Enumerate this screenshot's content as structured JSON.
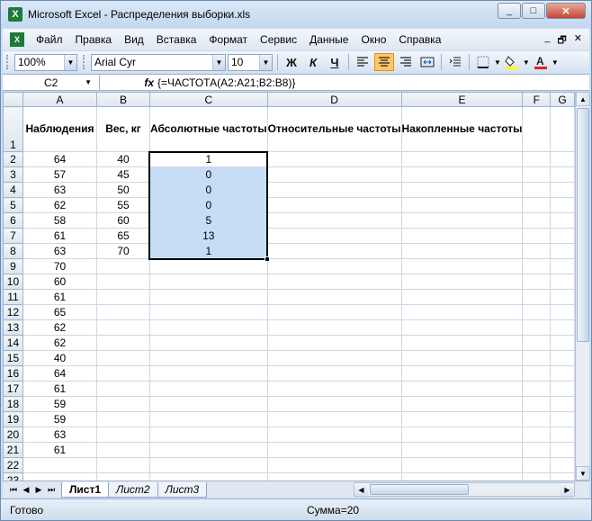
{
  "window": {
    "title": "Microsoft Excel - Распределения выборки.xls",
    "minimize": "_",
    "maximize": "□",
    "close": "✕"
  },
  "menu": {
    "items": [
      "Файл",
      "Правка",
      "Вид",
      "Вставка",
      "Формат",
      "Сервис",
      "Данные",
      "Окно",
      "Справка"
    ],
    "doc_minimize": "_",
    "doc_restore": "🗗",
    "doc_close": "✕"
  },
  "toolbar": {
    "zoom": "100%",
    "font_name": "Arial Cyr",
    "font_size": "10",
    "bold": "Ж",
    "italic": "К",
    "underline": "Ч",
    "font_color": "#e02020",
    "fill_color": "#ffff00"
  },
  "formula_bar": {
    "name_box": "C2",
    "fx": "fx",
    "formula": "{=ЧАСТОТА(A2:A21;B2:B8)}"
  },
  "sheet": {
    "columns": [
      "A",
      "B",
      "C",
      "D",
      "E",
      "F",
      "G"
    ],
    "header_row": {
      "row": "1",
      "A": "Наблюдения",
      "B": "Вес, кг",
      "C": "Абсолютные частоты",
      "D": "Относительные частоты",
      "E": "Накопленные частоты"
    },
    "rows": [
      {
        "row": "2",
        "A": "64",
        "B": "40",
        "C": "1"
      },
      {
        "row": "3",
        "A": "57",
        "B": "45",
        "C": "0"
      },
      {
        "row": "4",
        "A": "63",
        "B": "50",
        "C": "0"
      },
      {
        "row": "5",
        "A": "62",
        "B": "55",
        "C": "0"
      },
      {
        "row": "6",
        "A": "58",
        "B": "60",
        "C": "5"
      },
      {
        "row": "7",
        "A": "61",
        "B": "65",
        "C": "13"
      },
      {
        "row": "8",
        "A": "63",
        "B": "70",
        "C": "1"
      },
      {
        "row": "9",
        "A": "70",
        "B": "",
        "C": ""
      },
      {
        "row": "10",
        "A": "60",
        "B": "",
        "C": ""
      },
      {
        "row": "11",
        "A": "61",
        "B": "",
        "C": ""
      },
      {
        "row": "12",
        "A": "65",
        "B": "",
        "C": ""
      },
      {
        "row": "13",
        "A": "62",
        "B": "",
        "C": ""
      },
      {
        "row": "14",
        "A": "62",
        "B": "",
        "C": ""
      },
      {
        "row": "15",
        "A": "40",
        "B": "",
        "C": ""
      },
      {
        "row": "16",
        "A": "64",
        "B": "",
        "C": ""
      },
      {
        "row": "17",
        "A": "61",
        "B": "",
        "C": ""
      },
      {
        "row": "18",
        "A": "59",
        "B": "",
        "C": ""
      },
      {
        "row": "19",
        "A": "59",
        "B": "",
        "C": ""
      },
      {
        "row": "20",
        "A": "63",
        "B": "",
        "C": ""
      },
      {
        "row": "21",
        "A": "61",
        "B": "",
        "C": ""
      },
      {
        "row": "22",
        "A": "",
        "B": "",
        "C": ""
      },
      {
        "row": "23",
        "A": "",
        "B": "",
        "C": ""
      }
    ]
  },
  "tabs": {
    "nav_first": "⏮",
    "nav_prev": "◀",
    "nav_next": "▶",
    "nav_last": "⏭",
    "sheets": [
      "Лист1",
      "Лист2",
      "Лист3"
    ],
    "active": "Лист1"
  },
  "status": {
    "ready": "Готово",
    "sum": "Сумма=20"
  },
  "colors": {
    "selection_fill": "#c6ddf6",
    "header_highlight": "#f1c15f"
  }
}
